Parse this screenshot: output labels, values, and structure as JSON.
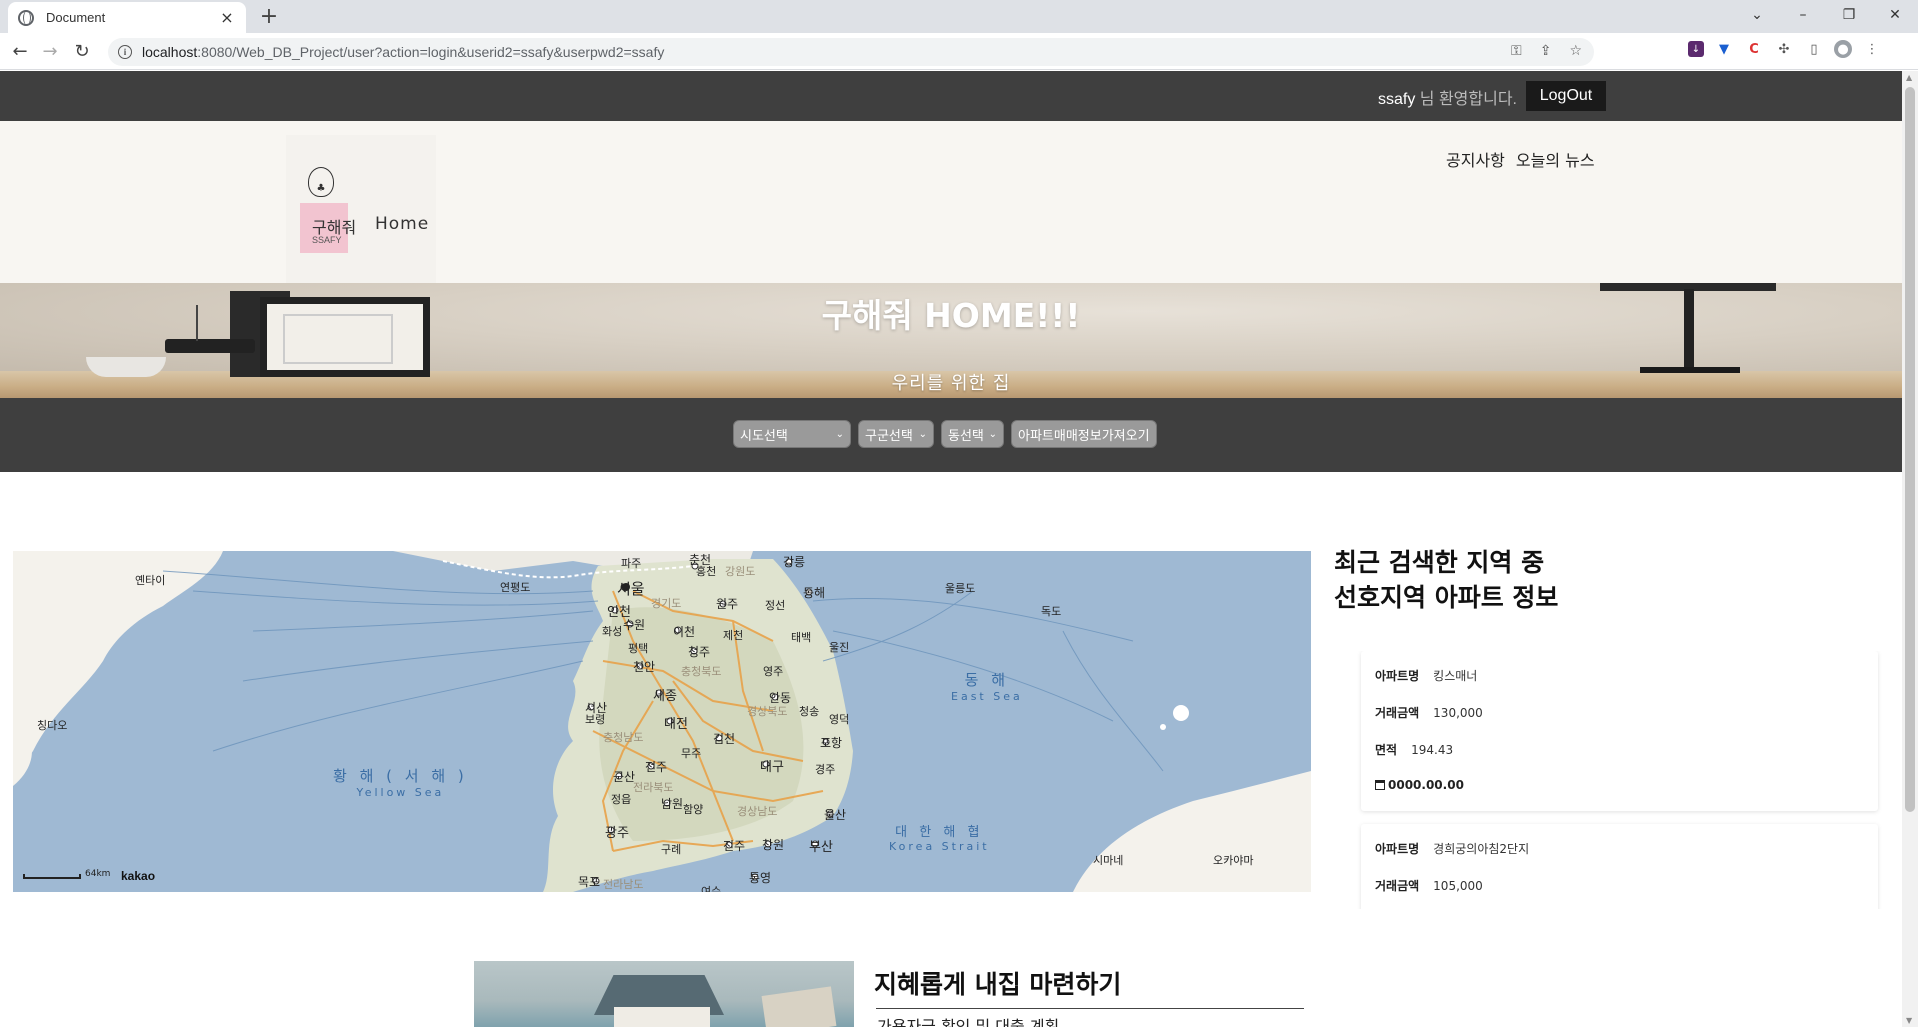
{
  "browser": {
    "tab_title": "Document",
    "url_host": "localhost",
    "url_rest": ":8080/Web_DB_Project/user?action=login&userid2=ssafy&userpwd2=ssafy"
  },
  "topbar": {
    "user": "ssafy",
    "welcome_suffix": " 님 환영합니다.",
    "logout_label": "LogOut"
  },
  "header": {
    "logo_word": "구해줘",
    "logo_ssafy": "SSAFY",
    "home_label": "Home",
    "nav": [
      "공지사항",
      "오늘의 뉴스"
    ]
  },
  "banner": {
    "title": "구해줘 HOME!!!",
    "subtitle": "우리를 위한 집"
  },
  "filters": {
    "sido": "시도선택",
    "gugun": "구군선택",
    "dong": "동선택",
    "fetch_label": "아파트매매정보가져오기"
  },
  "map": {
    "cities": [
      {
        "name": "서울"
      },
      {
        "name": "인천"
      },
      {
        "name": "수원"
      },
      {
        "name": "원주"
      },
      {
        "name": "강릉"
      },
      {
        "name": "춘천"
      },
      {
        "name": "동해"
      },
      {
        "name": "천안"
      },
      {
        "name": "세종"
      },
      {
        "name": "대전"
      },
      {
        "name": "청주"
      },
      {
        "name": "안동"
      },
      {
        "name": "포항"
      },
      {
        "name": "김천"
      },
      {
        "name": "대구"
      },
      {
        "name": "전주"
      },
      {
        "name": "군산"
      },
      {
        "name": "울산"
      },
      {
        "name": "광주"
      },
      {
        "name": "부산"
      },
      {
        "name": "진주"
      },
      {
        "name": "창원"
      },
      {
        "name": "목포"
      },
      {
        "name": "통영"
      },
      {
        "name": "남원"
      },
      {
        "name": "정읍"
      },
      {
        "name": "구례"
      },
      {
        "name": "보령"
      },
      {
        "name": "서산"
      },
      {
        "name": "평택"
      },
      {
        "name": "이천"
      },
      {
        "name": "제천"
      },
      {
        "name": "태백"
      },
      {
        "name": "울진"
      },
      {
        "name": "영주"
      },
      {
        "name": "경주"
      },
      {
        "name": "정선"
      },
      {
        "name": "파주"
      },
      {
        "name": "화성"
      },
      {
        "name": "여수"
      },
      {
        "name": "함양"
      },
      {
        "name": "영덕"
      },
      {
        "name": "홍천"
      },
      {
        "name": "청송"
      },
      {
        "name": "무주"
      }
    ],
    "overseas": [
      {
        "name": "옌타이"
      },
      {
        "name": "칭다오"
      },
      {
        "name": "독도"
      },
      {
        "name": "울릉도"
      },
      {
        "name": "시마네"
      },
      {
        "name": "오카야마"
      },
      {
        "name": "연평도"
      }
    ],
    "seas": [
      {
        "name": "황 해 ( 서 해 )",
        "sub": "Yellow Sea"
      },
      {
        "name": "동 해",
        "sub": "East Sea"
      },
      {
        "name": "대 한 해 협",
        "sub": "Korea Strait"
      }
    ],
    "regions": [
      "강원도",
      "경기도",
      "충청북도",
      "충청남도",
      "경상북도",
      "경상남도",
      "전라북도",
      "전라남도"
    ],
    "scale": "64km",
    "brand": "kakao"
  },
  "recent": {
    "title_line1": "최근 검색한 지역 중",
    "title_line2": "선호지역 아파트 정보",
    "labels": {
      "name": "아파트명",
      "price": "거래금액",
      "area": "면적"
    },
    "cards": [
      {
        "name": "킹스매너",
        "price": "130,000",
        "area": "194.43",
        "date": "0000.00.00"
      },
      {
        "name": "경희궁의아침2단지",
        "price": "105,000"
      }
    ]
  },
  "section": {
    "title": "지혜롭게 내집 마련하기",
    "subtitle": "가용자금 확인 및 대출 계획"
  }
}
